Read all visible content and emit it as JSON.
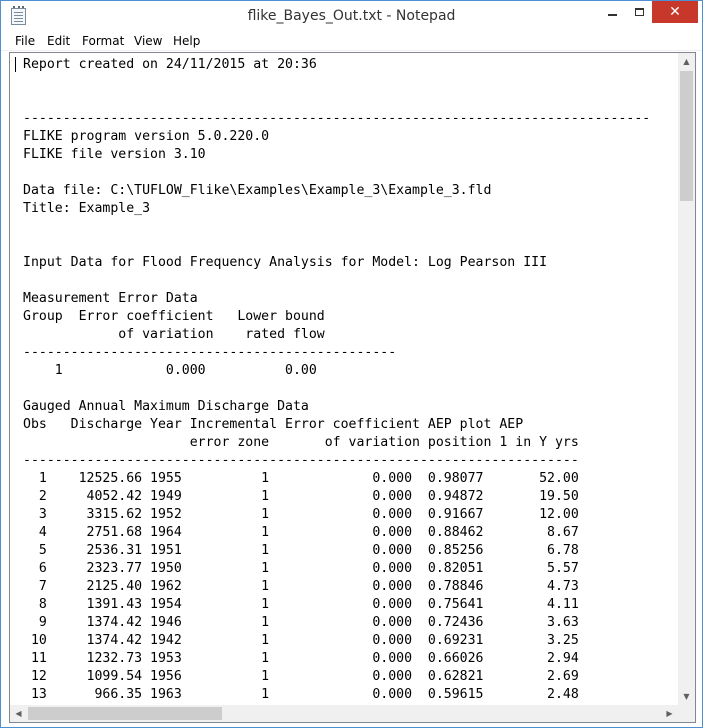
{
  "window": {
    "title": "flike_Bayes_Out.txt - Notepad",
    "icon": "notepad-icon",
    "controls": {
      "minimize": "minimize-icon",
      "maximize": "maximize-icon",
      "close_label": "✕"
    }
  },
  "menu": [
    "File",
    "Edit",
    "Format",
    "View",
    "Help"
  ],
  "document": {
    "lines": [
      "Report created on 24/11/2015 at 20:36",
      "",
      "",
      "-------------------------------------------------------------------------------",
      "FLIKE program version 5.0.220.0",
      "FLIKE file version 3.10",
      "",
      "Data file: C:\\TUFLOW_Flike\\Examples\\Example_3\\Example_3.fld",
      "Title: Example_3",
      "",
      "",
      "Input Data for Flood Frequency Analysis for Model: Log Pearson III",
      "",
      "Measurement Error Data",
      "Group  Error coefficient   Lower bound",
      "            of variation    rated flow",
      "-----------------------------------------------",
      "    1             0.000          0.00",
      "",
      "Gauged Annual Maximum Discharge Data",
      "Obs   Discharge Year Incremental Error coefficient AEP plot AEP",
      "                     error zone       of variation position 1 in Y yrs",
      "----------------------------------------------------------------------",
      "  1    12525.66 1955          1             0.000  0.98077       52.00",
      "  2     4052.42 1949          1             0.000  0.94872       19.50",
      "  3     3315.62 1952          1             0.000  0.91667       12.00",
      "  4     2751.68 1964          1             0.000  0.88462        8.67",
      "  5     2536.31 1951          1             0.000  0.85256        6.78",
      "  6     2323.77 1950          1             0.000  0.82051        5.57",
      "  7     2125.40 1962          1             0.000  0.78846        4.73",
      "  8     1391.43 1954          1             0.000  0.75641        4.11",
      "  9     1374.42 1946          1             0.000  0.72436        3.63",
      " 10     1374.42 1942          1             0.000  0.69231        3.25",
      " 11     1232.73 1953          1             0.000  0.66026        2.94",
      " 12     1099.54 1956          1             0.000  0.62821        2.69",
      " 13      966.35 1963          1             0.000  0.59615        2.48"
    ]
  },
  "scrollbars": {
    "vertical": {
      "position_fraction": 0.0
    },
    "horizontal": {
      "position_fraction": 0.0
    }
  },
  "colors": {
    "close_button": "#c7382b",
    "window_border": "#4d8fd0"
  }
}
